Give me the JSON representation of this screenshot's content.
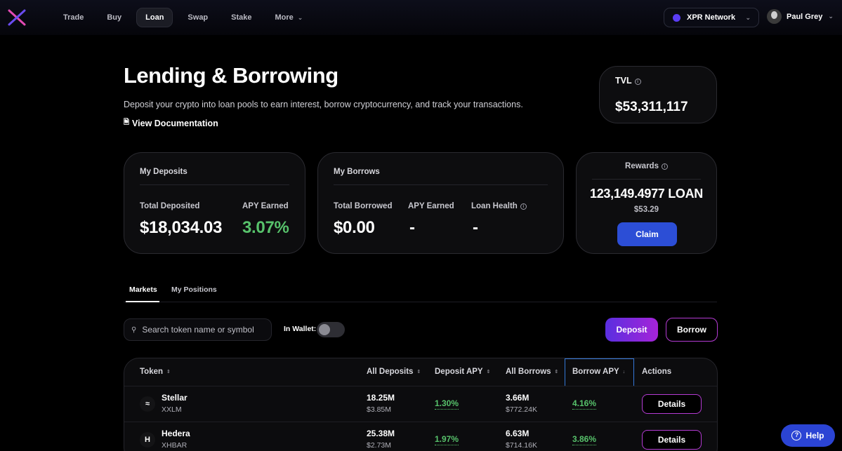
{
  "nav": {
    "items": [
      {
        "label": "Trade"
      },
      {
        "label": "Buy"
      },
      {
        "label": "Loan"
      },
      {
        "label": "Swap"
      },
      {
        "label": "Stake"
      },
      {
        "label": "More"
      }
    ],
    "active": "Loan",
    "network": "XPR Network",
    "user": "Paul Grey"
  },
  "hero": {
    "title": "Lending & Borrowing",
    "subtitle": "Deposit your crypto into loan pools to earn interest, borrow cryptocurrency, and track your transactions.",
    "doc_link": "View Documentation"
  },
  "tvl": {
    "label": "TVL",
    "value": "$53,311,117"
  },
  "deposits": {
    "title": "My Deposits",
    "total_label": "Total Deposited",
    "total_value": "$18,034.03",
    "apy_label": "APY Earned",
    "apy_value": "3.07%"
  },
  "borrows": {
    "title": "My Borrows",
    "total_label": "Total Borrowed",
    "total_value": "$0.00",
    "apy_label": "APY Earned",
    "apy_value": "-",
    "health_label": "Loan Health",
    "health_value": "-"
  },
  "rewards": {
    "title": "Rewards",
    "amount": "123,149.4977 LOAN",
    "usd": "$53.29",
    "claim_label": "Claim"
  },
  "tabs": [
    {
      "label": "Markets"
    },
    {
      "label": "My Positions"
    }
  ],
  "controls": {
    "search_placeholder": "Search token name or symbol",
    "wallet_label": "In Wallet:",
    "deposit_label": "Deposit",
    "borrow_label": "Borrow"
  },
  "table": {
    "headers": [
      "Token",
      "All Deposits",
      "Deposit APY",
      "All Borrows",
      "Borrow APY",
      "Actions"
    ],
    "rows": [
      {
        "name": "Stellar",
        "symbol": "XXLM",
        "deposits": "18.25M",
        "deposits_usd": "$3.85M",
        "deposit_apy": "1.30%",
        "borrows": "3.66M",
        "borrows_usd": "$772.24K",
        "borrow_apy": "4.16%",
        "action": "Details"
      },
      {
        "name": "Hedera",
        "symbol": "XHBAR",
        "deposits": "25.38M",
        "deposits_usd": "$2.73M",
        "deposit_apy": "1.97%",
        "borrows": "6.63M",
        "borrows_usd": "$714.16K",
        "borrow_apy": "3.86%",
        "action": "Details"
      }
    ]
  },
  "help_label": "Help",
  "colors": {
    "accent_green": "#57c26b",
    "claim_blue": "#2c4ed6",
    "gradient_start": "#5a2fe0",
    "gradient_end": "#a524d8"
  }
}
